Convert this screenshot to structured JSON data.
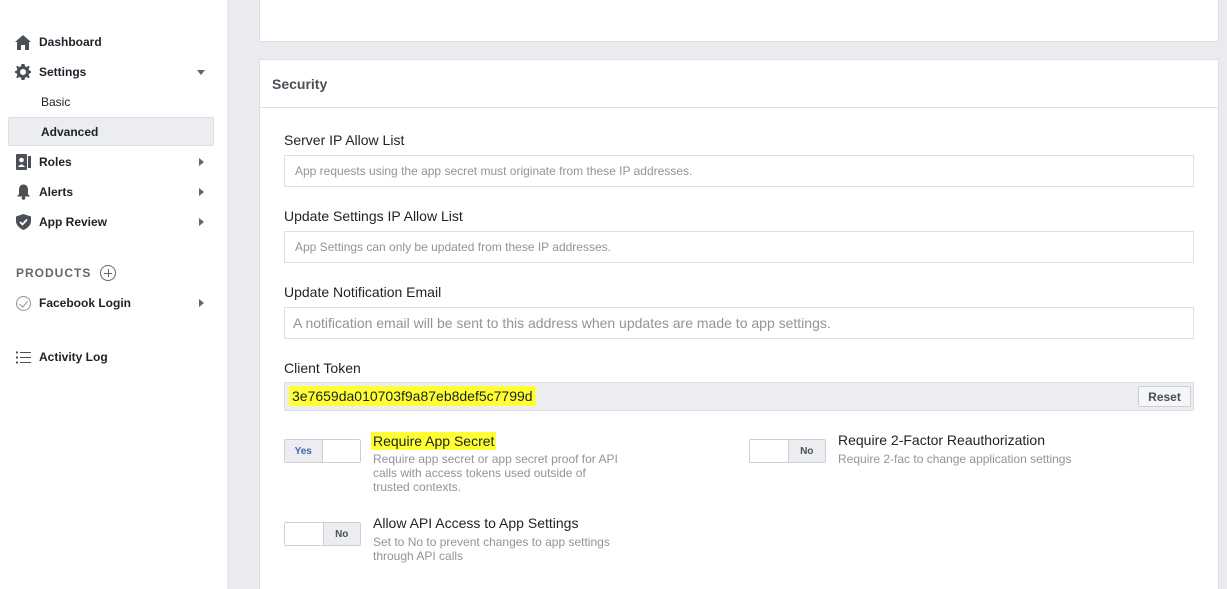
{
  "sidebar": {
    "items": [
      {
        "label": "Dashboard",
        "icon": "home-icon"
      },
      {
        "label": "Settings",
        "icon": "gear-icon"
      },
      {
        "label": "Roles",
        "icon": "roles-icon"
      },
      {
        "label": "Alerts",
        "icon": "bell-icon"
      },
      {
        "label": "App Review",
        "icon": "shield-icon"
      }
    ],
    "settings_sub": [
      {
        "label": "Basic"
      },
      {
        "label": "Advanced",
        "active": true
      }
    ],
    "products_label": "PRODUCTS",
    "products": [
      {
        "label": "Facebook Login",
        "icon": "check-circle-icon"
      }
    ],
    "activity_log": {
      "label": "Activity Log",
      "icon": "list-icon"
    }
  },
  "security": {
    "header": "Security",
    "server_ip": {
      "label": "Server IP Allow List",
      "placeholder": "App requests using the app secret must originate from these IP addresses."
    },
    "settings_ip": {
      "label": "Update Settings IP Allow List",
      "placeholder": "App Settings can only be updated from these IP addresses."
    },
    "notification_email": {
      "label": "Update Notification Email",
      "placeholder": "A notification email will be sent to this address when updates are made to app settings."
    },
    "client_token": {
      "label": "Client Token",
      "value": "3e7659da010703f9a87eb8def5c7799d",
      "reset_label": "Reset"
    },
    "options": {
      "require_app_secret": {
        "state": "Yes",
        "title": "Require App Secret",
        "desc": "Require app secret or app secret proof for API calls with access tokens used outside of trusted contexts."
      },
      "require_2fa": {
        "state": "No",
        "title": "Require 2-Factor Reauthorization",
        "desc": "Require 2-fac to change application settings"
      },
      "allow_api_access": {
        "state": "No",
        "title": "Allow API Access to App Settings",
        "desc": "Set to No to prevent changes to app settings through API calls"
      }
    }
  },
  "colors": {
    "highlight": "#ffff33",
    "accent": "#4267b2",
    "background": "#e9ebee"
  }
}
